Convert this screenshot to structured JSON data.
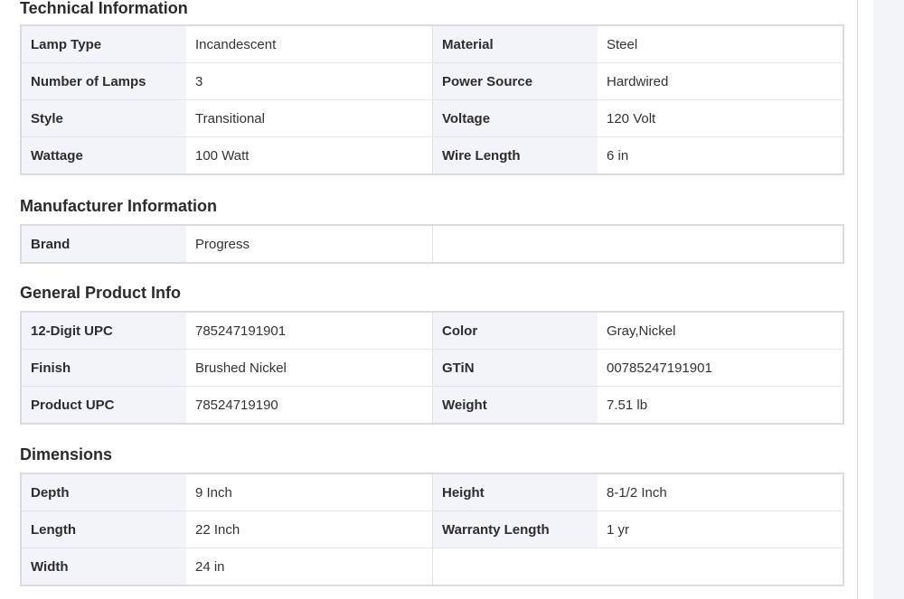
{
  "sections": [
    {
      "title": "Technical Information",
      "rows": [
        {
          "l1": "Lamp Type",
          "v1": "Incandescent",
          "l2": "Material",
          "v2": "Steel"
        },
        {
          "l1": "Number of Lamps",
          "v1": "3",
          "l2": "Power Source",
          "v2": "Hardwired"
        },
        {
          "l1": "Style",
          "v1": "Transitional",
          "l2": "Voltage",
          "v2": "120 Volt"
        },
        {
          "l1": "Wattage",
          "v1": "100 Watt",
          "l2": "Wire Length",
          "v2": "6 in"
        }
      ]
    },
    {
      "title": "Manufacturer Information",
      "rows": [
        {
          "l1": "Brand",
          "v1": "Progress"
        }
      ]
    },
    {
      "title": "General Product Info",
      "rows": [
        {
          "l1": "12-Digit UPC",
          "v1": "785247191901",
          "l2": "Color",
          "v2": "Gray,Nickel"
        },
        {
          "l1": "Finish",
          "v1": "Brushed Nickel",
          "l2": "GTiN",
          "v2": "00785247191901"
        },
        {
          "l1": "Product UPC",
          "v1": "78524719190",
          "l2": "Weight",
          "v2": "7.51 lb"
        }
      ]
    },
    {
      "title": "Dimensions",
      "rows": [
        {
          "l1": "Depth",
          "v1": "9 Inch",
          "l2": "Height",
          "v2": "8-1/2 Inch"
        },
        {
          "l1": "Length",
          "v1": "22 Inch",
          "l2": "Warranty Length",
          "v2": "1 yr"
        },
        {
          "l1": "Width",
          "v1": "24 in"
        }
      ]
    }
  ]
}
